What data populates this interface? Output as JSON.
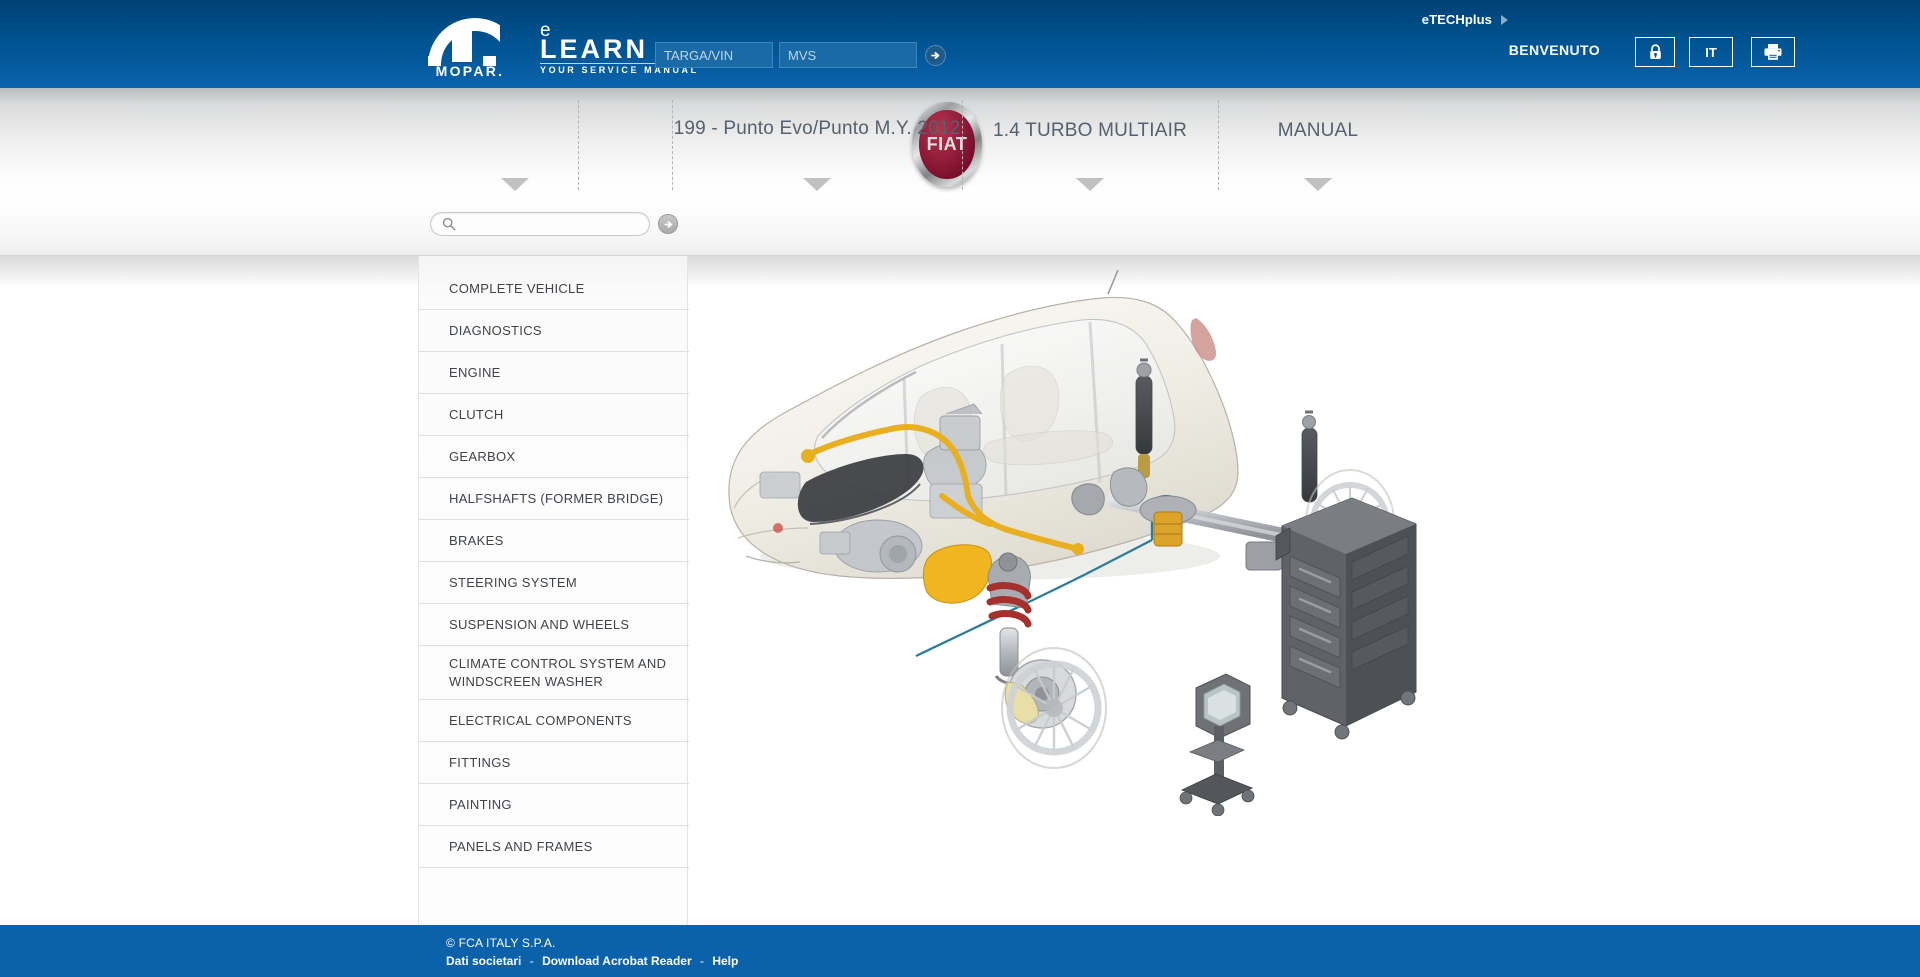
{
  "header": {
    "brand_primary": "MOPAR.",
    "brand_e": "e",
    "brand_learn": "LEARN",
    "brand_tagline": "YOUR SERVICE MANUAL",
    "vin_placeholder": "TARGA/VIN",
    "vin_value": "",
    "mvs_placeholder": "MVS",
    "mvs_value": "",
    "go_icon": "arrow-right-circle-icon",
    "etechplus_label": "eTECHplus",
    "etechplus_arrow_icon": "triangle-right-icon",
    "welcome_label": "BENVENUTO",
    "lock_icon": "lock-icon",
    "language_label": "IT",
    "print_icon": "printer-icon",
    "gradient_top": "#004176",
    "gradient_bottom": "#0a63ad"
  },
  "vehicle_nav": {
    "brand_logo": "fiat-logo",
    "brand_logo_text": "FIAT",
    "vehicle_photo": "fiat-punto-evo-photo",
    "model_label": "199 - Punto Evo/Punto M.Y. 2012",
    "engine_label": "1.4 TURBO MULTIAIR",
    "manual_label": "MANUAL",
    "caret_icon": "chevron-down-icon"
  },
  "search": {
    "placeholder": "",
    "value": "",
    "magnifier_icon": "search-icon",
    "submit_icon": "arrow-right-circle-icon"
  },
  "sidebar": {
    "items": [
      {
        "label": "COMPLETE VEHICLE"
      },
      {
        "label": "DIAGNOSTICS"
      },
      {
        "label": "ENGINE"
      },
      {
        "label": "CLUTCH"
      },
      {
        "label": "GEARBOX"
      },
      {
        "label": "HALFSHAFTS (FORMER BRIDGE)"
      },
      {
        "label": "BRAKES"
      },
      {
        "label": "STEERING SYSTEM"
      },
      {
        "label": "SUSPENSION AND WHEELS"
      },
      {
        "label": "CLIMATE CONTROL SYSTEM AND WINDSCREEN WASHER"
      },
      {
        "label": "ELECTRICAL COMPONENTS"
      },
      {
        "label": "FITTINGS"
      },
      {
        "label": "PAINTING"
      },
      {
        "label": "PANELS AND FRAMES"
      }
    ]
  },
  "main": {
    "illustration_name": "vehicle-cutaway-suspension-brakes-illustration",
    "illustration_description": "Cutaway view of Fiat Punto showing engine, suspension, shock absorbers, brake system plus a diagnostic tester stand and a tool cabinet"
  },
  "footer": {
    "copyright": "© FCA ITALY S.P.A.",
    "links": [
      {
        "label": "Dati societari"
      },
      {
        "label": "Download Acrobat Reader"
      },
      {
        "label": "Help"
      }
    ],
    "separator": "-",
    "background": "#0b62ab"
  }
}
